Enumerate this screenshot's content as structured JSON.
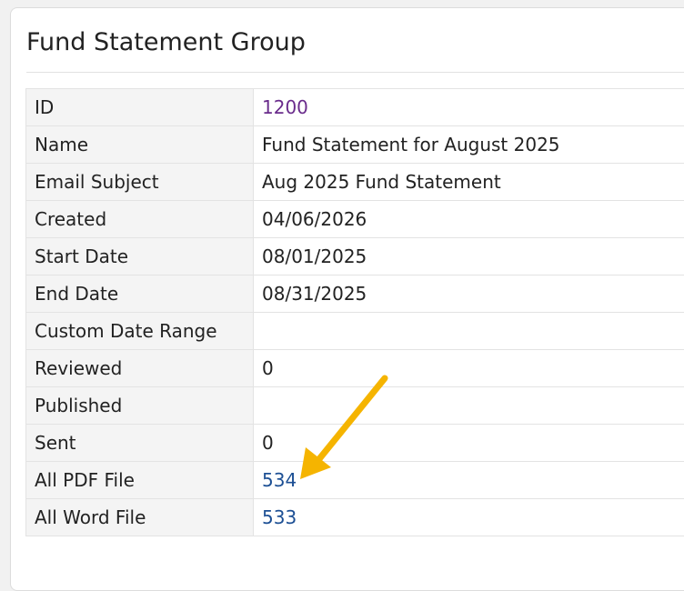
{
  "page": {
    "title": "Fund Statement Group"
  },
  "details": {
    "id": {
      "label": "ID",
      "value": "1200"
    },
    "name": {
      "label": "Name",
      "value": "Fund Statement for August 2025"
    },
    "email_subject": {
      "label": "Email Subject",
      "value": "Aug 2025 Fund Statement"
    },
    "created": {
      "label": "Created",
      "value": "04/06/2026"
    },
    "start_date": {
      "label": "Start Date",
      "value": "08/01/2025"
    },
    "end_date": {
      "label": "End Date",
      "value": "08/31/2025"
    },
    "custom_range": {
      "label": "Custom Date Range",
      "value": ""
    },
    "reviewed": {
      "label": "Reviewed",
      "value": "0"
    },
    "published": {
      "label": "Published",
      "value": ""
    },
    "sent": {
      "label": "Sent",
      "value": "0"
    },
    "all_pdf": {
      "label": "All PDF File",
      "value": "534"
    },
    "all_word": {
      "label": "All Word File",
      "value": "533"
    }
  },
  "colors": {
    "visited_link": "#6a2c8c",
    "link": "#1c4f94",
    "annotation_arrow": "#f5b400"
  },
  "annotation": {
    "icon": "arrow-icon",
    "points_to": "all_pdf"
  }
}
